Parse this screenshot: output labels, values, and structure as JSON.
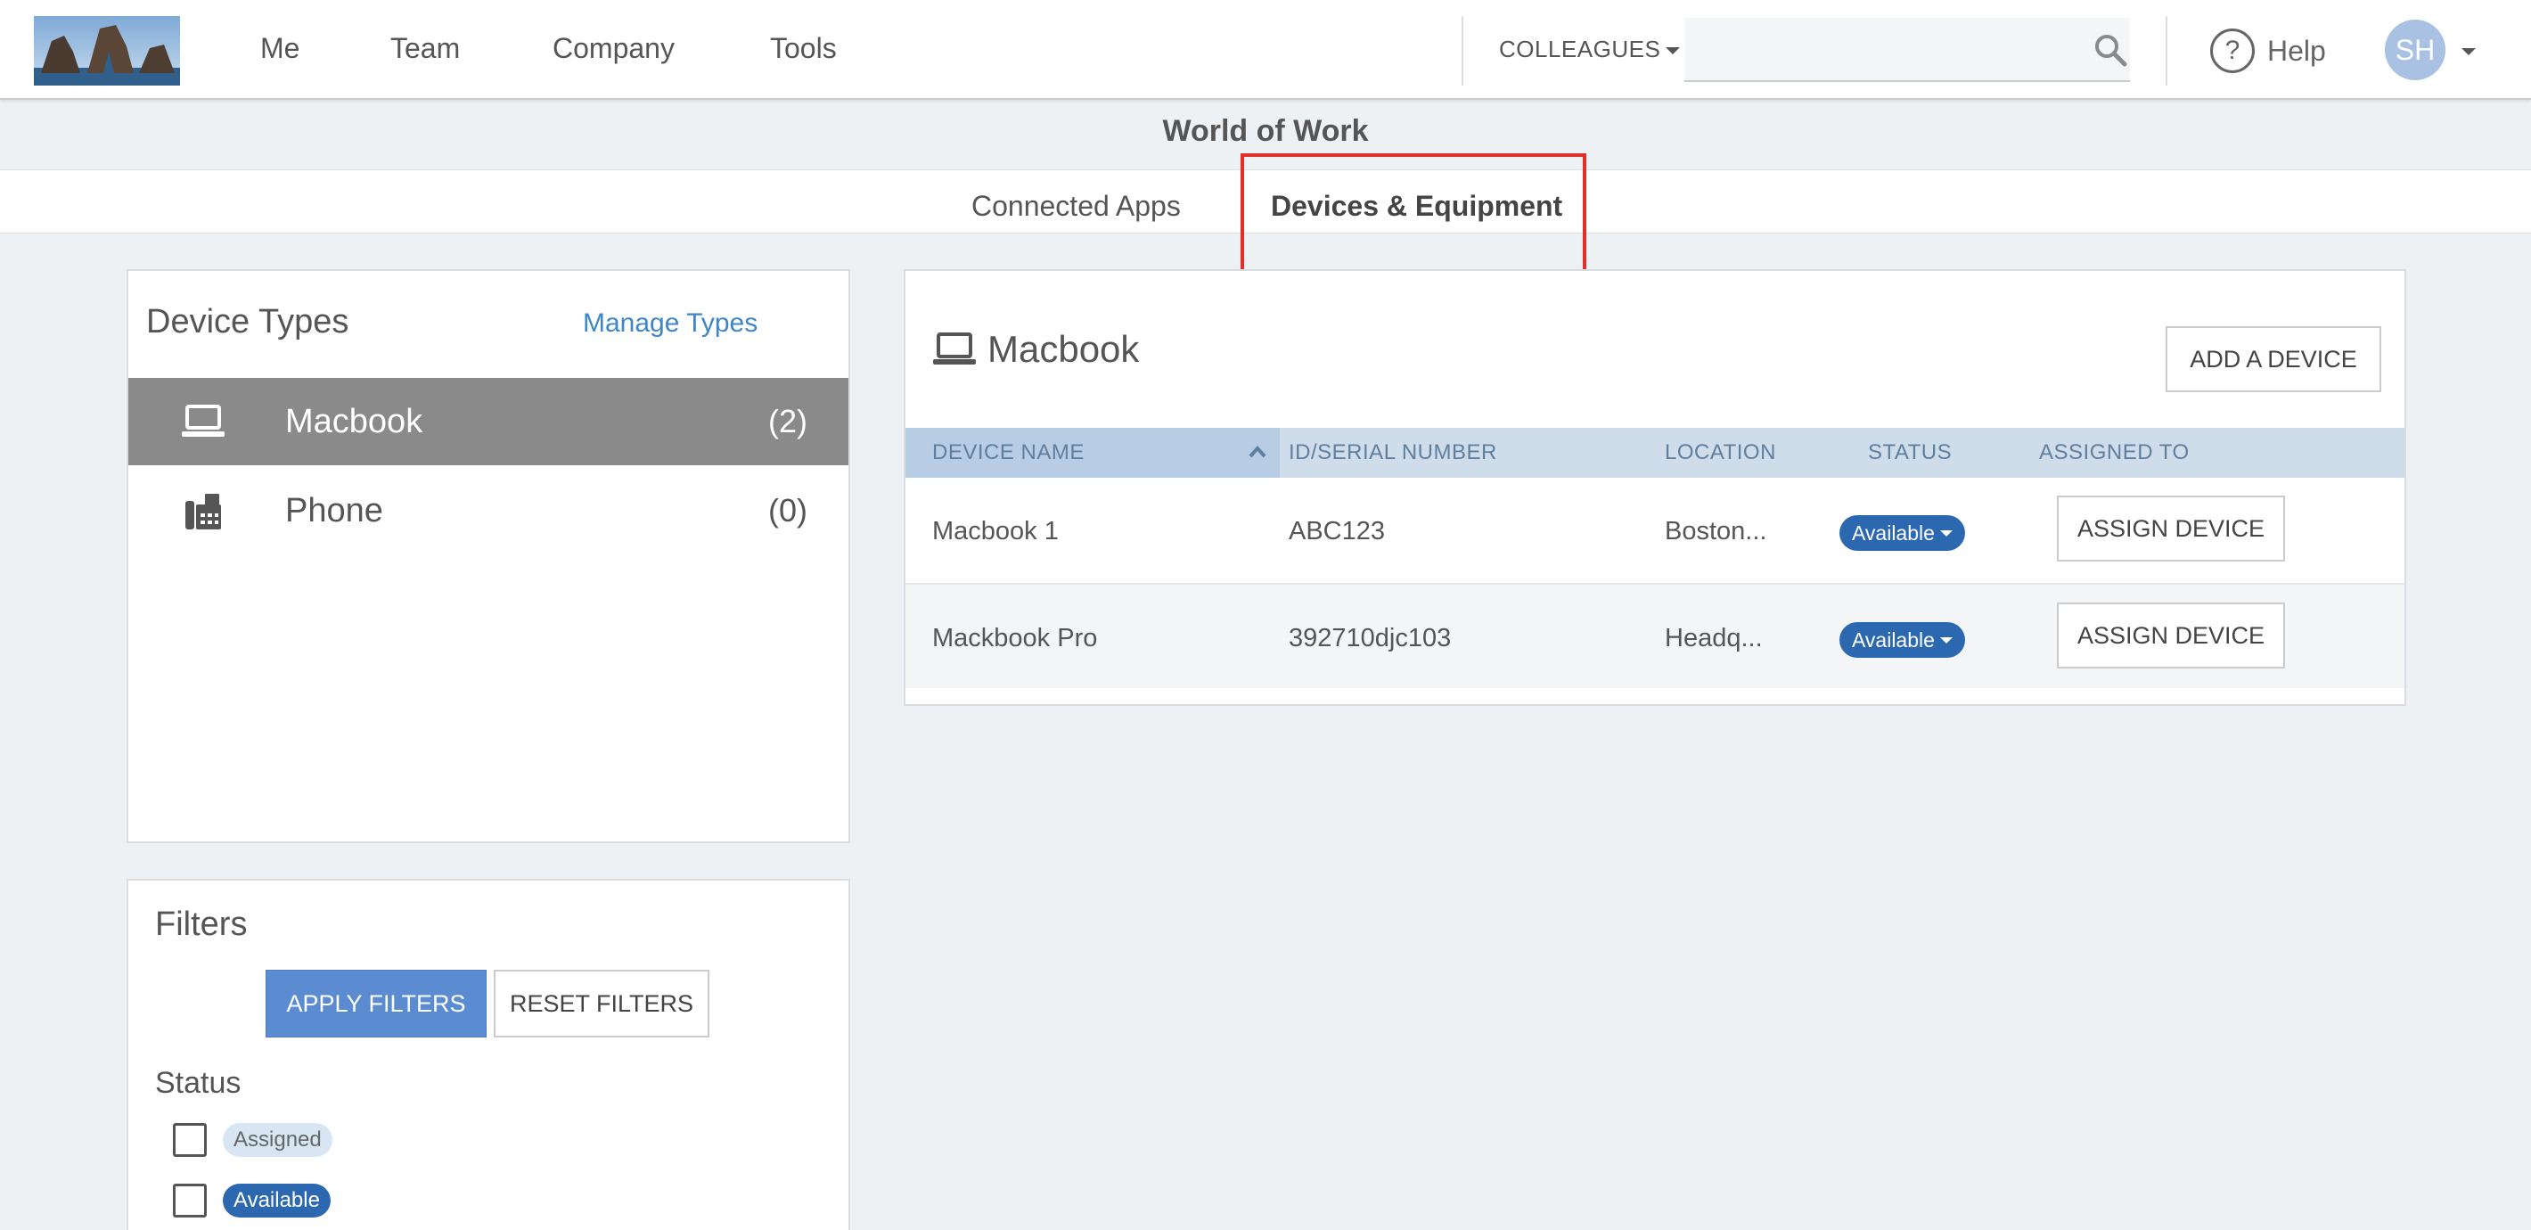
{
  "nav": {
    "items": [
      "Me",
      "Team",
      "Company",
      "Tools"
    ],
    "colleagues_label": "COLLEAGUES",
    "search_placeholder": "",
    "help_label": "Help",
    "help_symbol": "?",
    "avatar_initials": "SH"
  },
  "page_title": "World of Work",
  "tabs": [
    {
      "label": "Connected Apps",
      "active": false
    },
    {
      "label": "Devices & Equipment",
      "active": true
    }
  ],
  "device_types": {
    "title": "Device Types",
    "manage_link": "Manage Types",
    "items": [
      {
        "name": "Macbook",
        "count": "(2)",
        "icon": "laptop-icon",
        "selected": true
      },
      {
        "name": "Phone",
        "count": "(0)",
        "icon": "phone-icon",
        "selected": false
      }
    ]
  },
  "filters": {
    "title": "Filters",
    "apply_label": "APPLY FILTERS",
    "reset_label": "RESET FILTERS",
    "status_label": "Status",
    "options": [
      {
        "label": "Assigned",
        "checked": false
      },
      {
        "label": "Available",
        "checked": false
      }
    ]
  },
  "devices": {
    "title": "Macbook",
    "add_label": "ADD A DEVICE",
    "columns": [
      "DEVICE NAME",
      "ID/SERIAL NUMBER",
      "LOCATION",
      "STATUS",
      "ASSIGNED TO"
    ],
    "rows": [
      {
        "name": "Macbook 1",
        "serial": "ABC123",
        "location": "Boston...",
        "status": "Available",
        "action": "ASSIGN DEVICE"
      },
      {
        "name": "Mackbook Pro",
        "serial": "392710djc103",
        "location": "Headq...",
        "status": "Available",
        "action": "ASSIGN DEVICE"
      }
    ]
  },
  "colors": {
    "accent": "#3c86c9",
    "primary_button": "#5b8bd0",
    "status_pill": "#2b68b0",
    "selected_row": "#8a8a8a",
    "table_header": "#cfdcea",
    "highlight": "#e0302a"
  }
}
